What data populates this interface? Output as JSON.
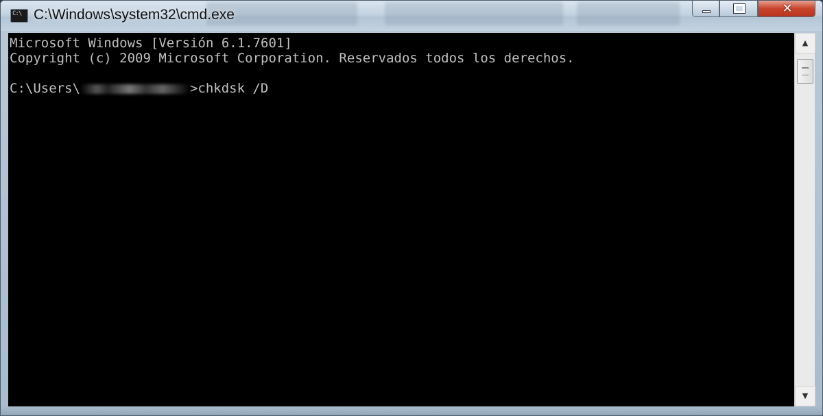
{
  "window": {
    "title": "C:\\Windows\\system32\\cmd.exe",
    "icon": "cmd-icon",
    "icon_text": "C:\\"
  },
  "controls": {
    "minimize": "minimize-icon",
    "maximize": "maximize-icon",
    "close": "close-icon",
    "close_glyph": "✕"
  },
  "console": {
    "line1": "Microsoft Windows [Versión 6.1.7601]",
    "line2": "Copyright (c) 2009 Microsoft Corporation. Reservados todos los derechos.",
    "prompt_prefix": "C:\\Users\\",
    "prompt_suffix": ">chkdsk /D"
  },
  "scrollbar": {
    "up_glyph": "▲",
    "down_glyph": "▼"
  },
  "colors": {
    "console_bg": "#000000",
    "console_fg": "#c0c0c0",
    "close_button": "#c8442c"
  }
}
